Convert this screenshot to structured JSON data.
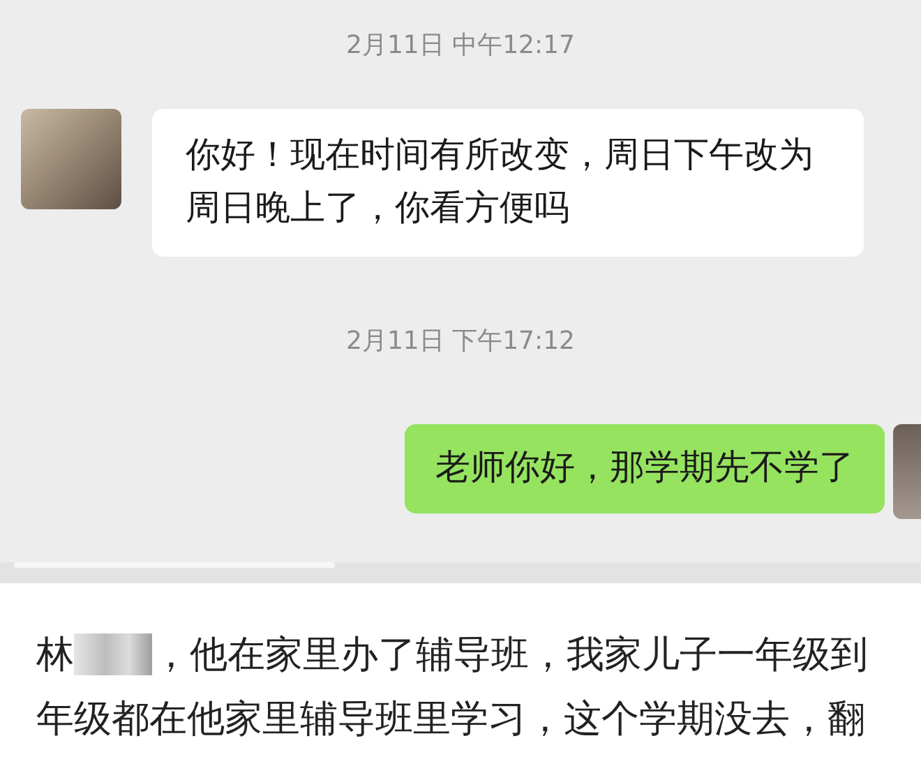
{
  "chat": {
    "messages": [
      {
        "kind": "timestamp",
        "text": "2月11日 中午12:17"
      },
      {
        "kind": "incoming",
        "text": "你好！现在时间有所改变，周日下午改为周日晚上了，你看方便吗"
      },
      {
        "kind": "timestamp",
        "text": "2月11日 下午17:12"
      },
      {
        "kind": "outgoing",
        "text": "老师你好，那学期先不学了"
      }
    ]
  },
  "article": {
    "lines": [
      {
        "parts": [
          "林",
          "，他在家里办了辅导班，我家儿子一年级到"
        ]
      },
      {
        "parts": [
          "年级都在他家里辅导班里学习，这个学期没去，翻"
        ]
      }
    ]
  }
}
